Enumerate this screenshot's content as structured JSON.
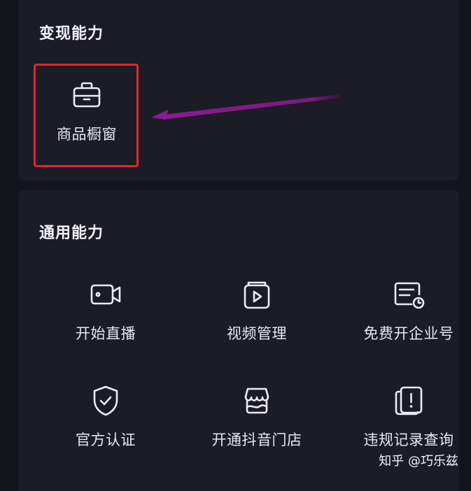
{
  "monetization": {
    "title": "变现能力",
    "items": [
      {
        "label": "商品橱窗",
        "icon": "briefcase-icon"
      }
    ]
  },
  "general": {
    "title": "通用能力",
    "items": [
      {
        "label": "开始直播",
        "icon": "video-camera-icon"
      },
      {
        "label": "视频管理",
        "icon": "video-folder-icon"
      },
      {
        "label": "免费开企业号",
        "icon": "enterprise-card-icon"
      },
      {
        "label": "官方认证",
        "icon": "shield-check-icon"
      },
      {
        "label": "开通抖音门店",
        "icon": "storefront-icon"
      },
      {
        "label": "违规记录查询",
        "icon": "violation-record-icon"
      }
    ]
  },
  "annotation": {
    "highlight_color": "#e5232d",
    "arrow_color": "#8a1c8e"
  },
  "watermark": "知乎 @巧乐兹",
  "colors": {
    "background": "#14141d",
    "card": "#1c1c27",
    "text": "#eeeef2"
  }
}
